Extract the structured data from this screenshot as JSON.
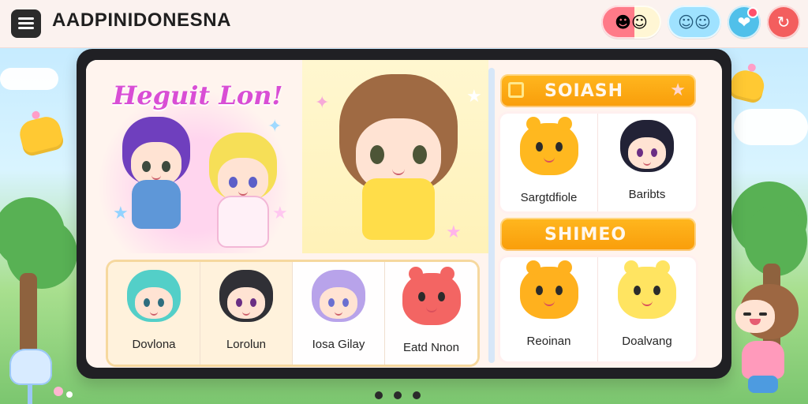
{
  "app": {
    "title": "AADPINIDONESNA"
  },
  "header": {
    "menu_icon": "menu-icon",
    "icons": [
      "friends-icon",
      "chat-icon",
      "heart-notification-icon",
      "refresh-icon"
    ]
  },
  "hero": {
    "title": "Heguit Lon!"
  },
  "bottom_cards": [
    {
      "label": "Dovlona"
    },
    {
      "label": "Lorolun"
    },
    {
      "label": "Iosa Gilay"
    },
    {
      "label": "Eatd Nnon"
    }
  ],
  "right_panel": {
    "section1_title": "SOIASH",
    "section1_cards": [
      {
        "label": "Sargtdfiole"
      },
      {
        "label": "Baribts"
      }
    ],
    "section2_title": "SHIMEO",
    "section2_cards": [
      {
        "label": "Reoinan"
      },
      {
        "label": "Doalvang"
      }
    ]
  },
  "colors": {
    "accent_orange": "#ffb11e",
    "accent_pink": "#d94ed5",
    "panel_bg": "#fff4ee",
    "dark_frame": "#202024"
  }
}
